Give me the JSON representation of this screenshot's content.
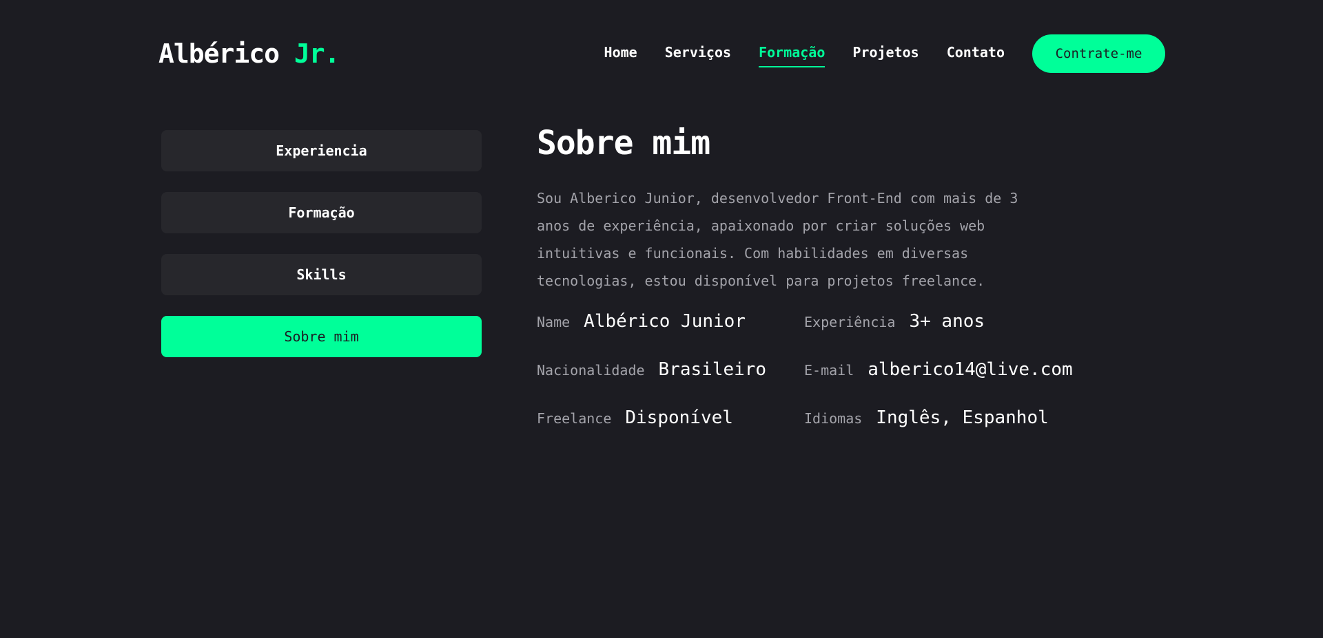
{
  "header": {
    "logo_name": "Albérico",
    "logo_accent": "Jr.",
    "nav": [
      {
        "label": "Home"
      },
      {
        "label": "Serviços"
      },
      {
        "label": "Formação"
      },
      {
        "label": "Projetos"
      },
      {
        "label": "Contato"
      }
    ],
    "active_nav": "Formação",
    "cta_label": "Contrate-me"
  },
  "tabs": [
    {
      "label": "Experiencia"
    },
    {
      "label": "Formação"
    },
    {
      "label": "Skills"
    },
    {
      "label": "Sobre mim"
    }
  ],
  "active_tab": "Sobre mim",
  "about": {
    "title": "Sobre mim",
    "description": "Sou Alberico Junior, desenvolvedor Front-End com mais de 3 anos de experiência, apaixonado por criar soluções web intuitivas e funcionais. Com habilidades em diversas tecnologias, estou disponível para projetos freelance.",
    "info": [
      {
        "label": "Name",
        "value": "Albérico Junior"
      },
      {
        "label": "Experiência",
        "value": "3+ anos"
      },
      {
        "label": "Nacionalidade",
        "value": "Brasileiro"
      },
      {
        "label": "E-mail",
        "value": "alberico14@live.com"
      },
      {
        "label": "Freelance",
        "value": "Disponível"
      },
      {
        "label": "Idiomas",
        "value": "Inglês, Espanhol"
      }
    ]
  },
  "colors": {
    "background": "#1c1c22",
    "accent": "#00ff99",
    "tab_background": "#27272c",
    "muted_text": "#a3a3aa"
  }
}
